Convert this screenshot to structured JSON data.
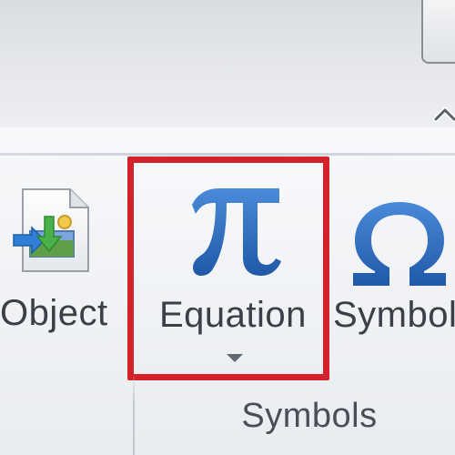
{
  "ribbon": {
    "commands": {
      "object": {
        "label": "Object"
      },
      "equation": {
        "label": "Equation"
      },
      "symbol": {
        "label": "Symbol"
      }
    },
    "group": {
      "label": "Symbols"
    }
  },
  "icons": {
    "object": "insert-object-icon",
    "equation": "pi-icon",
    "symbol": "omega-icon",
    "dropdown": "dropdown-arrow-icon",
    "collapse": "collapse-ribbon-icon"
  },
  "colors": {
    "highlight_border": "#d3222a",
    "icon_blue": "#2f6fc0",
    "label_text": "#3b4048"
  }
}
